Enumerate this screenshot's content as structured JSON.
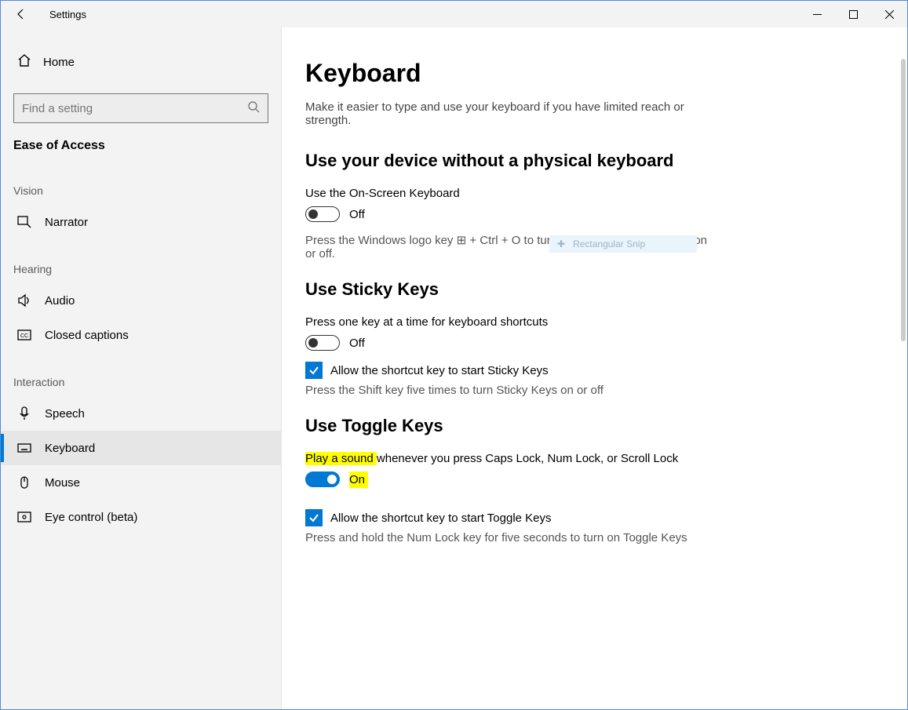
{
  "window": {
    "title": "Settings"
  },
  "sidebar": {
    "home": "Home",
    "search_placeholder": "Find a setting",
    "section": "Ease of Access",
    "groups": {
      "vision": "Vision",
      "hearing": "Hearing",
      "interaction": "Interaction"
    },
    "items": {
      "narrator": "Narrator",
      "audio": "Audio",
      "closed_captions": "Closed captions",
      "speech": "Speech",
      "keyboard": "Keyboard",
      "mouse": "Mouse",
      "eye_control": "Eye control (beta)"
    }
  },
  "main": {
    "title": "Keyboard",
    "subtitle": "Make it easier to type and use your keyboard if you have limited reach or strength.",
    "section1": {
      "heading": "Use your device without a physical keyboard",
      "osk_label": "Use the On-Screen Keyboard",
      "osk_state": "Off",
      "osk_help_pre": "Press the Windows logo key ",
      "osk_help_post": " + Ctrl + O to turn the On-Screen Keyboard on or off."
    },
    "section2": {
      "heading": "Use Sticky Keys",
      "label": "Press one key at a time for keyboard shortcuts",
      "state": "Off",
      "check_label": "Allow the shortcut key to start Sticky Keys",
      "help": "Press the Shift key five times to turn Sticky Keys on or off"
    },
    "section3": {
      "heading": "Use Toggle Keys",
      "label_hl": "Play a sound ",
      "label_rest": "whenever you press Caps Lock, Num Lock, or Scroll Lock",
      "state": "On",
      "check_label": "Allow the shortcut key to start Toggle Keys",
      "help": "Press and hold the Num Lock key for five seconds to turn on Toggle Keys"
    }
  },
  "snip": {
    "label": "Rectangular Snip"
  }
}
